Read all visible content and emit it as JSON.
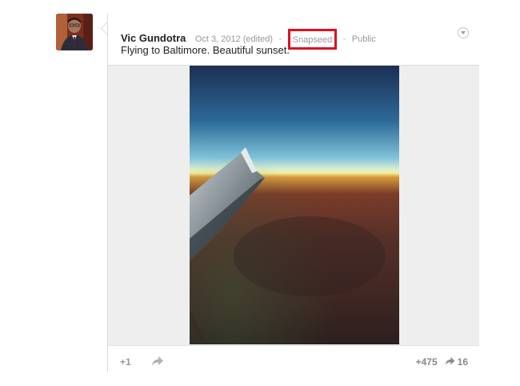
{
  "post": {
    "author": "Vic Gundotra",
    "date": "Oct 3, 2012 (edited)",
    "separator": "-",
    "app": "Snapseed",
    "visibility": "Public",
    "text": "Flying to Baltimore. Beautiful sunset.",
    "menu_icon": "chevron-down-circle-icon",
    "highlight_color": "#e0101e"
  },
  "actions": {
    "plus_one": "+1",
    "share_icon": "share-arrow-icon",
    "plus_count": "+475",
    "share_count": "16"
  }
}
